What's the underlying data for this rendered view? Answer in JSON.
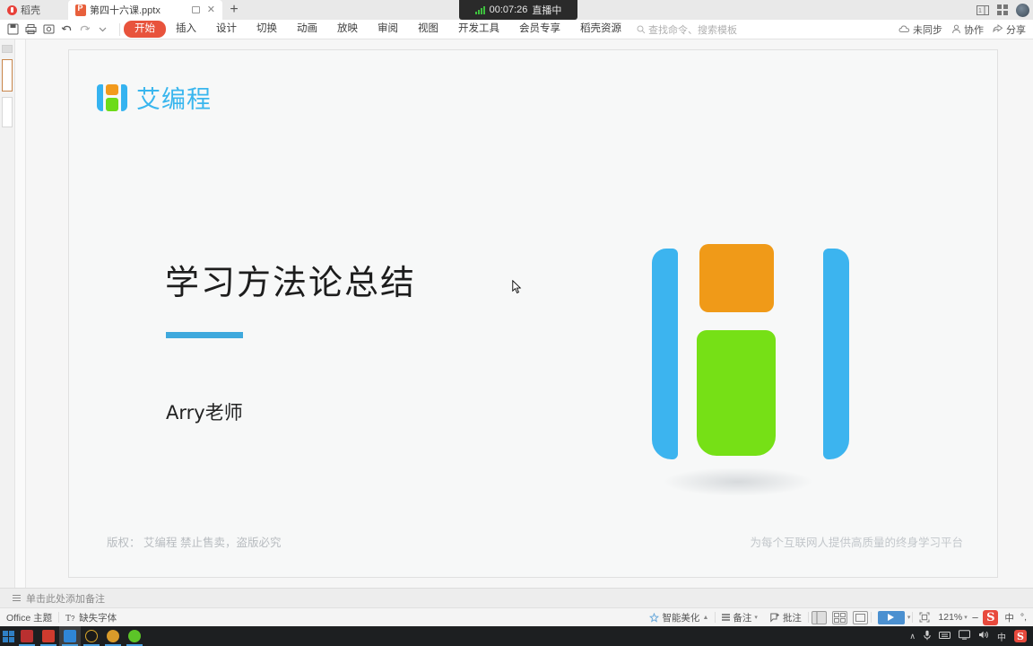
{
  "titlebar": {
    "docer_tab": "稻壳",
    "doc_tab": "第四十六课.pptx",
    "restore_label": "□",
    "close_label": "✕",
    "newtab_label": "+"
  },
  "live": {
    "timer": "00:07:26",
    "status": "直播中",
    "signal_icon": "signal-bars-icon"
  },
  "window_controls": {
    "layout_icon": "split-layout-icon",
    "apps_icon": "app-grid-icon",
    "avatar_icon": "user-avatar"
  },
  "ribbon": {
    "quick_access": [
      {
        "name": "save-icon",
        "label": "保存"
      },
      {
        "name": "print-icon",
        "label": "打印"
      },
      {
        "name": "print-preview-icon",
        "label": "打印预览"
      },
      {
        "name": "undo-icon",
        "label": "撤销"
      },
      {
        "name": "redo-icon",
        "label": "恢复"
      },
      {
        "name": "customize-qat-icon",
        "label": "自定义快速访问工具栏"
      }
    ],
    "tabs": [
      {
        "label": "开始",
        "active": true
      },
      {
        "label": "插入",
        "active": false
      },
      {
        "label": "设计",
        "active": false
      },
      {
        "label": "切换",
        "active": false
      },
      {
        "label": "动画",
        "active": false
      },
      {
        "label": "放映",
        "active": false
      },
      {
        "label": "审阅",
        "active": false
      },
      {
        "label": "视图",
        "active": false
      },
      {
        "label": "开发工具",
        "active": false
      },
      {
        "label": "会员专享",
        "active": false
      },
      {
        "label": "稻壳资源",
        "active": false
      }
    ],
    "search_placeholder": "查找命令、搜索模板",
    "right_items": [
      {
        "icon": "cloud-sync-icon",
        "label": "未同步"
      },
      {
        "icon": "collaborate-icon",
        "label": "协作"
      },
      {
        "icon": "share-icon",
        "label": "分享"
      }
    ]
  },
  "slide": {
    "brand_name": "艾编程",
    "brand_mark": "aibiancheng-logo-icon",
    "title": "学习方法论总结",
    "subtitle": "Arry老师",
    "footer_left": "版权： 艾编程  禁止售卖，盗版必究",
    "footer_right": "为每个互联网人提供高质量的终身学习平台",
    "accent_color": "#3fa9dd",
    "logo_colors": {
      "blue": "#3cb4ef",
      "orange": "#f09a18",
      "green": "#76e016"
    },
    "background": "#f7f8f8"
  },
  "notes": {
    "placeholder": "单击此处添加备注"
  },
  "status": {
    "theme": "Office 主题",
    "font_warning": "缺失字体",
    "beautify": "智能美化",
    "speaker_notes": "备注",
    "comments": "批注",
    "zoom_level": "121%",
    "views": [
      {
        "name": "normal-view-button",
        "selected": true
      },
      {
        "name": "slide-sorter-button",
        "selected": false
      },
      {
        "name": "reading-view-button",
        "selected": false
      }
    ],
    "play_button": "play-slideshow-button",
    "zoom_out": "−",
    "wps_badge": "S",
    "ime_label": "中"
  },
  "taskbar": {
    "items": [
      {
        "name": "start-button",
        "color": "#2f7fc4"
      },
      {
        "name": "taskbar-app-1",
        "color": "#b93030"
      },
      {
        "name": "taskbar-app-2",
        "color": "#cf3b2e"
      },
      {
        "name": "taskbar-app-wps",
        "color": "#2f86d6"
      },
      {
        "name": "taskbar-app-3",
        "color": "#1a1a1a"
      },
      {
        "name": "taskbar-app-4",
        "color": "#d89a2a"
      },
      {
        "name": "taskbar-app-5",
        "color": "#5cc428"
      }
    ],
    "tray": {
      "chevron": "∧",
      "mic_icon": "microphone-icon",
      "keyboard_icon": "keyboard-icon",
      "display_icon": "display-icon",
      "volume_icon": "volume-icon",
      "ime": "中",
      "wps_icon": "wps-tray-icon"
    }
  }
}
